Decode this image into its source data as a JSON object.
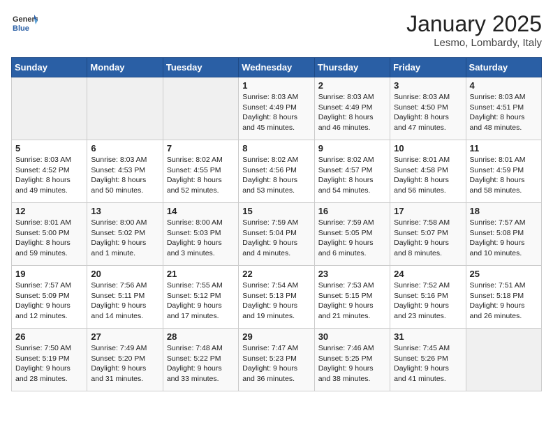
{
  "logo": {
    "general": "General",
    "blue": "Blue"
  },
  "title": "January 2025",
  "subtitle": "Lesmo, Lombardy, Italy",
  "headers": [
    "Sunday",
    "Monday",
    "Tuesday",
    "Wednesday",
    "Thursday",
    "Friday",
    "Saturday"
  ],
  "weeks": [
    [
      {
        "day": "",
        "info": ""
      },
      {
        "day": "",
        "info": ""
      },
      {
        "day": "",
        "info": ""
      },
      {
        "day": "1",
        "info": "Sunrise: 8:03 AM\nSunset: 4:49 PM\nDaylight: 8 hours\nand 45 minutes."
      },
      {
        "day": "2",
        "info": "Sunrise: 8:03 AM\nSunset: 4:49 PM\nDaylight: 8 hours\nand 46 minutes."
      },
      {
        "day": "3",
        "info": "Sunrise: 8:03 AM\nSunset: 4:50 PM\nDaylight: 8 hours\nand 47 minutes."
      },
      {
        "day": "4",
        "info": "Sunrise: 8:03 AM\nSunset: 4:51 PM\nDaylight: 8 hours\nand 48 minutes."
      }
    ],
    [
      {
        "day": "5",
        "info": "Sunrise: 8:03 AM\nSunset: 4:52 PM\nDaylight: 8 hours\nand 49 minutes."
      },
      {
        "day": "6",
        "info": "Sunrise: 8:03 AM\nSunset: 4:53 PM\nDaylight: 8 hours\nand 50 minutes."
      },
      {
        "day": "7",
        "info": "Sunrise: 8:02 AM\nSunset: 4:55 PM\nDaylight: 8 hours\nand 52 minutes."
      },
      {
        "day": "8",
        "info": "Sunrise: 8:02 AM\nSunset: 4:56 PM\nDaylight: 8 hours\nand 53 minutes."
      },
      {
        "day": "9",
        "info": "Sunrise: 8:02 AM\nSunset: 4:57 PM\nDaylight: 8 hours\nand 54 minutes."
      },
      {
        "day": "10",
        "info": "Sunrise: 8:01 AM\nSunset: 4:58 PM\nDaylight: 8 hours\nand 56 minutes."
      },
      {
        "day": "11",
        "info": "Sunrise: 8:01 AM\nSunset: 4:59 PM\nDaylight: 8 hours\nand 58 minutes."
      }
    ],
    [
      {
        "day": "12",
        "info": "Sunrise: 8:01 AM\nSunset: 5:00 PM\nDaylight: 8 hours\nand 59 minutes."
      },
      {
        "day": "13",
        "info": "Sunrise: 8:00 AM\nSunset: 5:02 PM\nDaylight: 9 hours\nand 1 minute."
      },
      {
        "day": "14",
        "info": "Sunrise: 8:00 AM\nSunset: 5:03 PM\nDaylight: 9 hours\nand 3 minutes."
      },
      {
        "day": "15",
        "info": "Sunrise: 7:59 AM\nSunset: 5:04 PM\nDaylight: 9 hours\nand 4 minutes."
      },
      {
        "day": "16",
        "info": "Sunrise: 7:59 AM\nSunset: 5:05 PM\nDaylight: 9 hours\nand 6 minutes."
      },
      {
        "day": "17",
        "info": "Sunrise: 7:58 AM\nSunset: 5:07 PM\nDaylight: 9 hours\nand 8 minutes."
      },
      {
        "day": "18",
        "info": "Sunrise: 7:57 AM\nSunset: 5:08 PM\nDaylight: 9 hours\nand 10 minutes."
      }
    ],
    [
      {
        "day": "19",
        "info": "Sunrise: 7:57 AM\nSunset: 5:09 PM\nDaylight: 9 hours\nand 12 minutes."
      },
      {
        "day": "20",
        "info": "Sunrise: 7:56 AM\nSunset: 5:11 PM\nDaylight: 9 hours\nand 14 minutes."
      },
      {
        "day": "21",
        "info": "Sunrise: 7:55 AM\nSunset: 5:12 PM\nDaylight: 9 hours\nand 17 minutes."
      },
      {
        "day": "22",
        "info": "Sunrise: 7:54 AM\nSunset: 5:13 PM\nDaylight: 9 hours\nand 19 minutes."
      },
      {
        "day": "23",
        "info": "Sunrise: 7:53 AM\nSunset: 5:15 PM\nDaylight: 9 hours\nand 21 minutes."
      },
      {
        "day": "24",
        "info": "Sunrise: 7:52 AM\nSunset: 5:16 PM\nDaylight: 9 hours\nand 23 minutes."
      },
      {
        "day": "25",
        "info": "Sunrise: 7:51 AM\nSunset: 5:18 PM\nDaylight: 9 hours\nand 26 minutes."
      }
    ],
    [
      {
        "day": "26",
        "info": "Sunrise: 7:50 AM\nSunset: 5:19 PM\nDaylight: 9 hours\nand 28 minutes."
      },
      {
        "day": "27",
        "info": "Sunrise: 7:49 AM\nSunset: 5:20 PM\nDaylight: 9 hours\nand 31 minutes."
      },
      {
        "day": "28",
        "info": "Sunrise: 7:48 AM\nSunset: 5:22 PM\nDaylight: 9 hours\nand 33 minutes."
      },
      {
        "day": "29",
        "info": "Sunrise: 7:47 AM\nSunset: 5:23 PM\nDaylight: 9 hours\nand 36 minutes."
      },
      {
        "day": "30",
        "info": "Sunrise: 7:46 AM\nSunset: 5:25 PM\nDaylight: 9 hours\nand 38 minutes."
      },
      {
        "day": "31",
        "info": "Sunrise: 7:45 AM\nSunset: 5:26 PM\nDaylight: 9 hours\nand 41 minutes."
      },
      {
        "day": "",
        "info": ""
      }
    ]
  ]
}
